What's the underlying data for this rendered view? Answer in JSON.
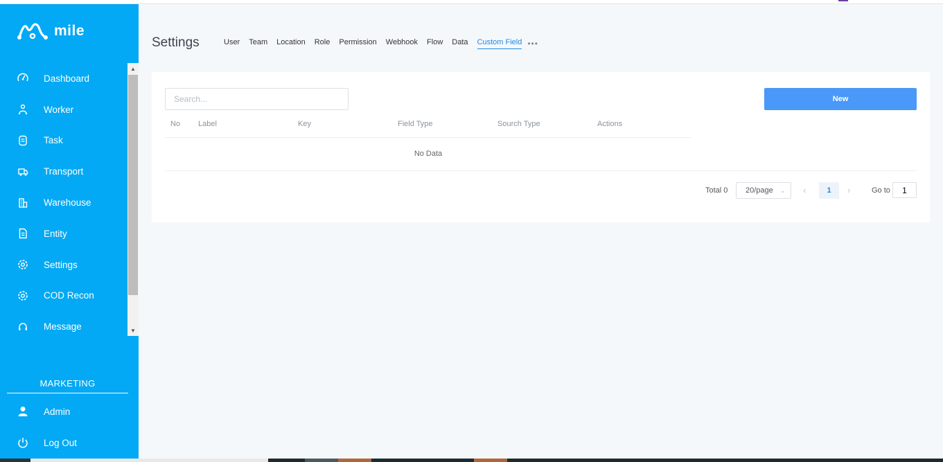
{
  "app": {
    "name": "mile",
    "brand_color": "#03a9f4",
    "accent_color": "#4a98f7"
  },
  "sidebar": {
    "items": [
      {
        "label": "Dashboard",
        "icon": "speedometer-icon"
      },
      {
        "label": "Worker",
        "icon": "worker-icon"
      },
      {
        "label": "Task",
        "icon": "task-icon"
      },
      {
        "label": "Transport",
        "icon": "truck-icon"
      },
      {
        "label": "Warehouse",
        "icon": "warehouse-icon"
      },
      {
        "label": "Entity",
        "icon": "document-icon"
      },
      {
        "label": "Settings",
        "icon": "gear-icon"
      },
      {
        "label": "COD Recon",
        "icon": "gear-icon"
      },
      {
        "label": "Message",
        "icon": "headset-icon"
      }
    ],
    "section_title": "MARKETING",
    "bottom_items": [
      {
        "label": "Admin",
        "icon": "user-icon"
      },
      {
        "label": "Log Out",
        "icon": "power-icon"
      }
    ]
  },
  "header": {
    "title": "Settings",
    "tabs": [
      "User",
      "Team",
      "Location",
      "Role",
      "Permission",
      "Webhook",
      "Flow",
      "Data",
      "Custom Field"
    ],
    "active_tab": "Custom Field",
    "more": "•••"
  },
  "toolbar": {
    "search_placeholder": "Search...",
    "new_label": "New"
  },
  "table": {
    "columns": [
      "No",
      "Label",
      "Key",
      "Field Type",
      "Sourch Type",
      "Actions"
    ],
    "rows": [],
    "empty_text": "No Data"
  },
  "pagination": {
    "total_label": "Total 0",
    "page_size": "20/page",
    "current_page": "1",
    "goto_label": "Go to",
    "goto_value": "1",
    "prev": "‹",
    "next": "›"
  }
}
